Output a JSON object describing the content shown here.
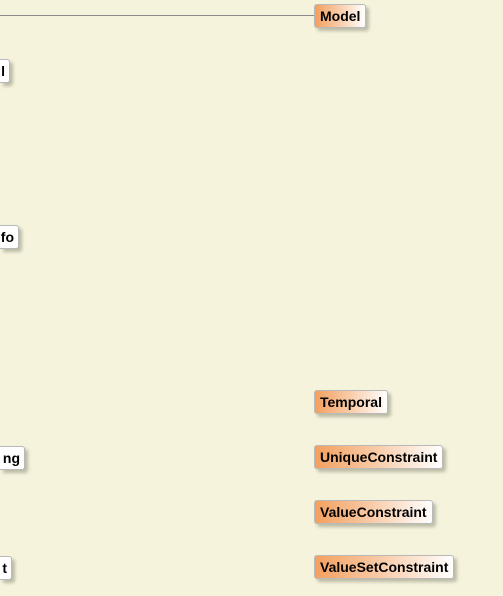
{
  "diagram": {
    "nodes": {
      "model": "Model",
      "temporal": "Temporal",
      "unique_constraint": "UniqueConstraint",
      "value_constraint": "ValueConstraint",
      "value_set_constraint": "ValueSetConstraint"
    },
    "partial_nodes": {
      "row1": "l",
      "row2": "fo",
      "row3": "ng",
      "row4": "t"
    }
  },
  "colors": {
    "background": "#f5f3dc",
    "node_gradient_start": "#f3a05f",
    "node_gradient_end": "#ffffff",
    "connector": "#8a8a8a"
  }
}
